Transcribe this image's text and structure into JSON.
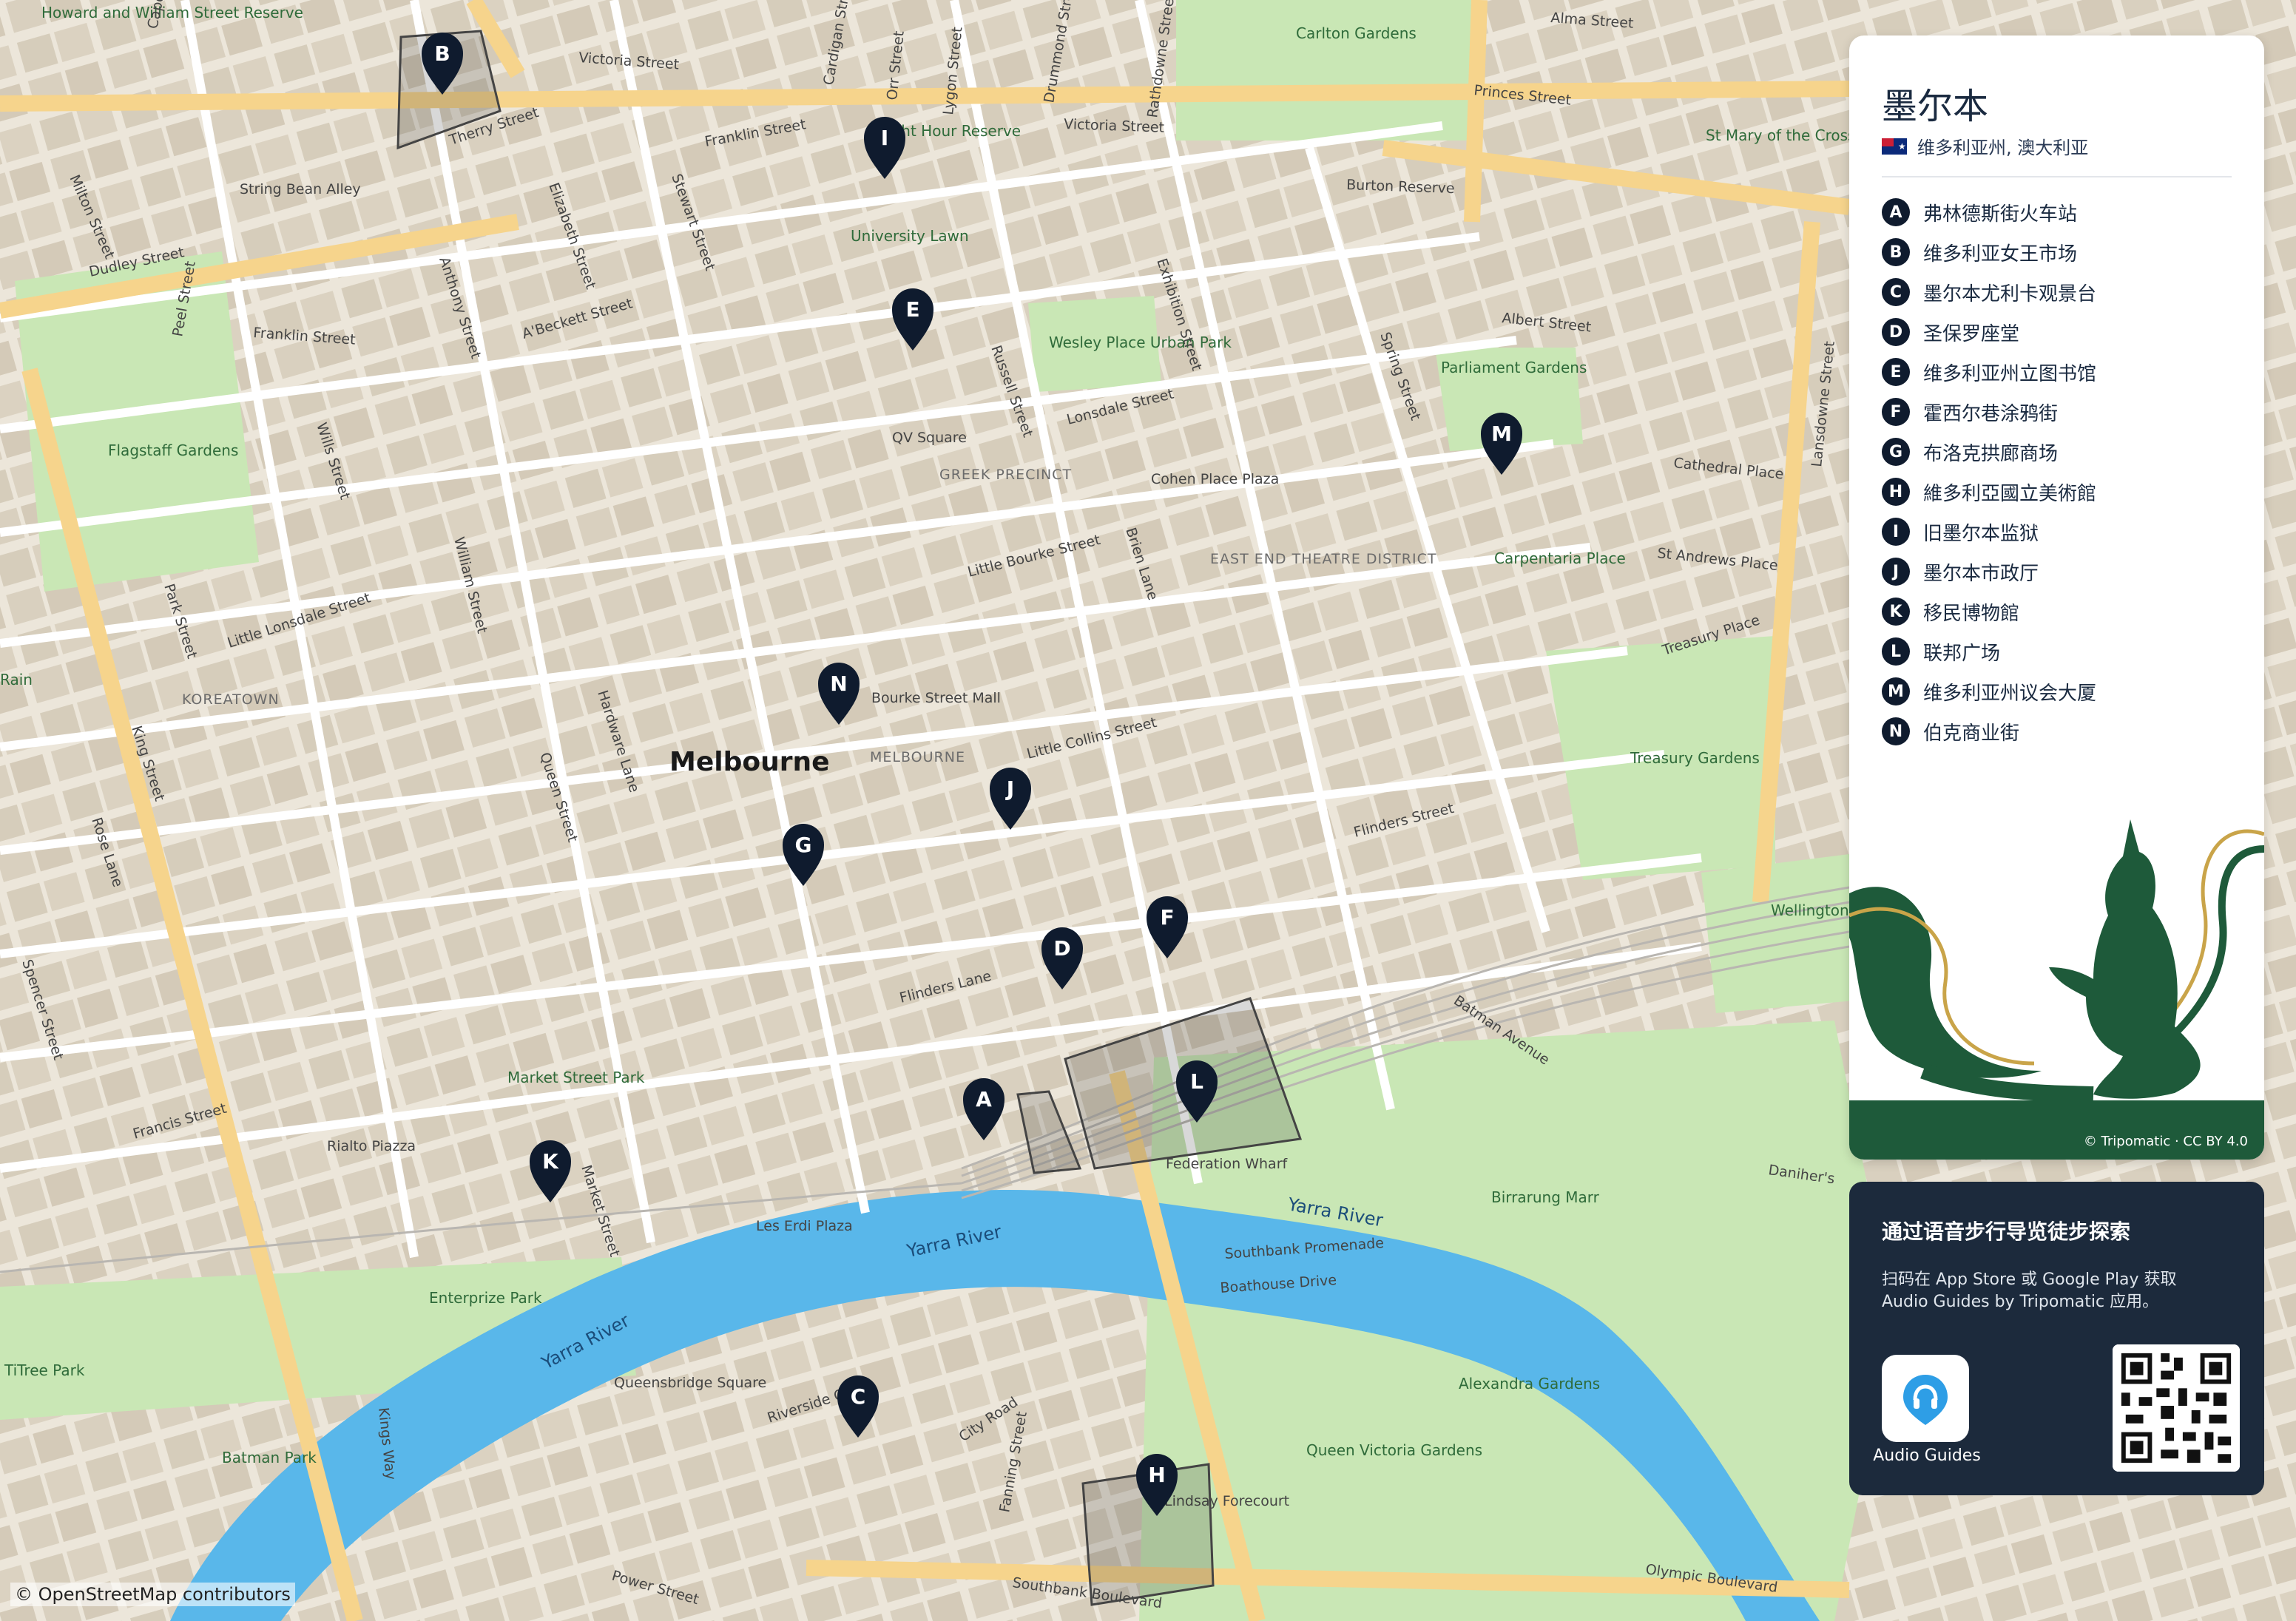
{
  "map": {
    "city_label": "Melbourne",
    "district_labels": [
      "GREEK PRECINCT",
      "EAST END THEATRE DISTRICT",
      "KOREATOWN",
      "MELBOURNE"
    ],
    "area_labels": [
      "Howard and William Street Reserve",
      "Carlton Gardens",
      "Flagstaff Gardens",
      "University Lawn",
      "Fight Hour Reserve",
      "Wesley Place Urban Park",
      "QV Square",
      "Cohen Place Plaza",
      "Parliament Gardens",
      "Carpentaria Place",
      "Treasury Gardens",
      "Wellington Park",
      "Market Street Park",
      "Rialto Piazza",
      "Bourke Street Mall",
      "Enterprize Park",
      "Batman Park",
      "Queensbridge Square",
      "Alexandra Gardens",
      "Queen Victoria Gardens",
      "Birrarung Marr",
      "Federation Wharf",
      "Les Erdi Plaza",
      "St Mary of the Cross Square",
      "String Bean Alley",
      "TiTree Park",
      "Rain"
    ],
    "water_labels": [
      "Yarra River",
      "Yarra River",
      "Yarra River"
    ],
    "street_labels": [
      "Victoria Street",
      "Victoria Street",
      "Franklin Street",
      "Franklin Street",
      "Therry Street",
      "Elizabeth Street",
      "Stewart Street",
      "Cardigan Street",
      "Orr Street",
      "Lygon Street",
      "Drummond Street",
      "Rathdowne Street",
      "Alma Street",
      "Princes Street",
      "Burton Reserve",
      "Russell Street",
      "Exhibition Street",
      "Albert Street",
      "Spring Street",
      "Cathedral Place",
      "St Andrews Place",
      "Treasury Place",
      "Lansdowne Street",
      "Lonsdale Street",
      "Little Bourke Street",
      "Little Collins Street",
      "Flinders Lane",
      "Flinders Street",
      "Queen Street",
      "King Street",
      "William Street",
      "Spencer Street",
      "Capel Street",
      "Peel Street",
      "Dudley Street",
      "Milton Street",
      "Anthony Street",
      "A'Beckett Street",
      "Wills Street",
      "Hardware Lane",
      "Park Street",
      "Little Lonsdale Street",
      "Rose Lane",
      "Francis Street",
      "Market Street",
      "Brien Lane",
      "Batman Avenue",
      "Southbank Promenade",
      "Boathouse Drive",
      "Riverside Quay",
      "City Road",
      "Fanning Street",
      "Power Street",
      "Southbank Boulevard",
      "Olympic Boulevard",
      "Kings Way",
      "Lindsay Forecourt",
      "Daniher's"
    ],
    "credit": "© OpenStreetMap contributors"
  },
  "markers": [
    {
      "id": "A",
      "name": "弗林德斯街火车站"
    },
    {
      "id": "B",
      "name": "维多利亚女王市场"
    },
    {
      "id": "C",
      "name": "墨尔本尤利卡观景台"
    },
    {
      "id": "D",
      "name": "圣保罗座堂"
    },
    {
      "id": "E",
      "name": "维多利亚州立图书馆"
    },
    {
      "id": "F",
      "name": "霍西尔巷涂鸦街"
    },
    {
      "id": "G",
      "name": "布洛克拱廊商场"
    },
    {
      "id": "H",
      "name": "維多利亞國立美術館"
    },
    {
      "id": "I",
      "name": "旧墨尔本监狱"
    },
    {
      "id": "J",
      "name": "墨尔本市政厅"
    },
    {
      "id": "K",
      "name": "移民博物館"
    },
    {
      "id": "L",
      "name": "联邦广场"
    },
    {
      "id": "M",
      "name": "维多利亚州议会大厦"
    },
    {
      "id": "N",
      "name": "伯克商业街"
    }
  ],
  "panel": {
    "title": "墨尔本",
    "subtitle": "维多利亚州, 澳大利亚",
    "credit": "© Tripomatic · CC BY 4.0"
  },
  "promo": {
    "title": "通过语音步行导览徒步探索",
    "text": "扫码在 App Store 或 Google Play 获取 Audio Guides by Tripomatic 应用。",
    "app_label": "Audio Guides"
  },
  "colors": {
    "marker": "#0f1b2e",
    "park": "#c8e6b4",
    "water": "#58b6e9",
    "block": "#d7cfbd",
    "major_road": "#f7d68f",
    "panel_art": "#1e5a3a"
  }
}
